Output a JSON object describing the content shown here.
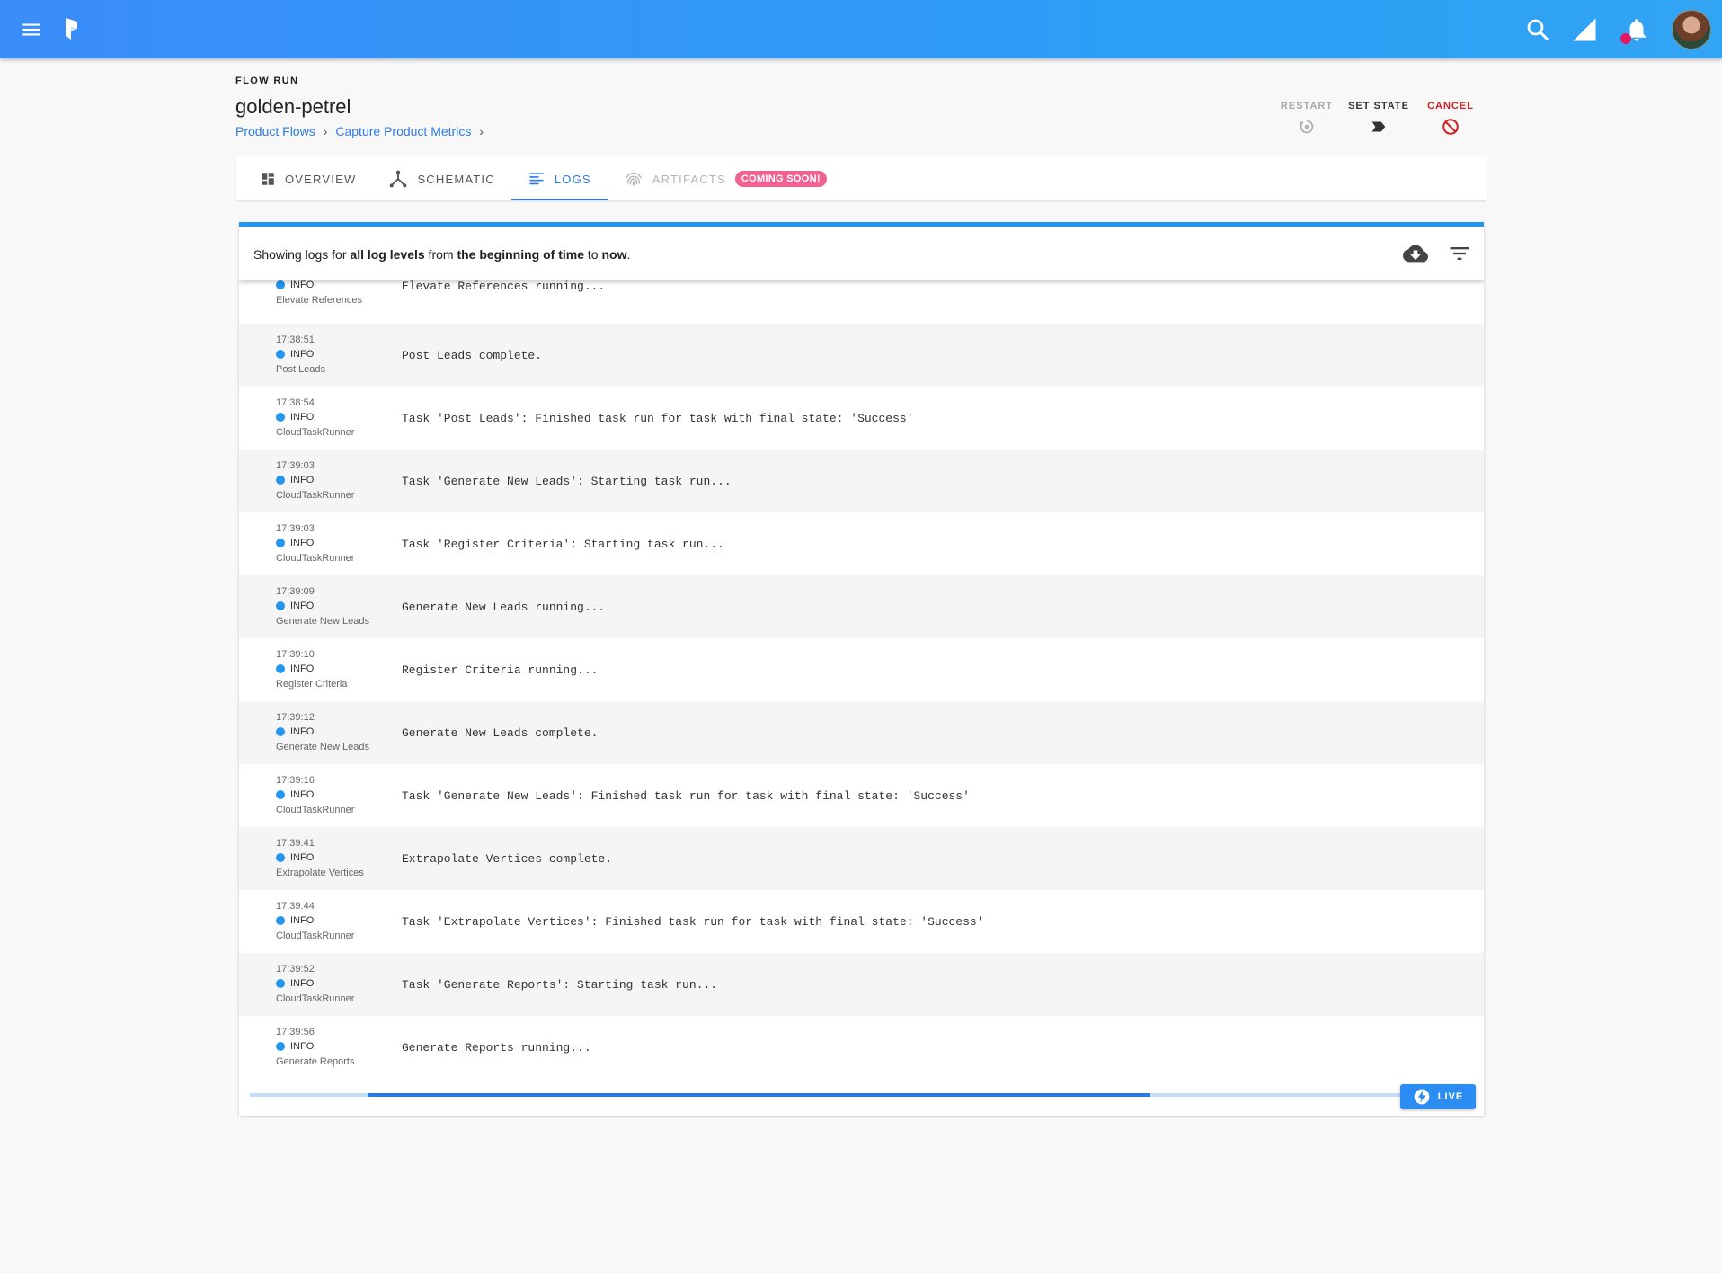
{
  "header": {
    "overline": "FLOW RUN",
    "title": "golden-petrel",
    "breadcrumbs": [
      "Product Flows",
      "Capture Product Metrics"
    ]
  },
  "actions": {
    "restart": "RESTART",
    "set_state": "SET STATE",
    "cancel": "CANCEL"
  },
  "tabs": [
    {
      "label": "OVERVIEW",
      "icon": "dashboard-icon"
    },
    {
      "label": "SCHEMATIC",
      "icon": "schematic-icon"
    },
    {
      "label": "LOGS",
      "icon": "logs-icon",
      "active": true
    },
    {
      "label": "ARTIFACTS",
      "icon": "fingerprint-icon",
      "disabled": true,
      "badge": "COMING SOON!"
    }
  ],
  "log_summary": {
    "prefix": "Showing logs for ",
    "levels": "all log levels",
    "from_word": " from ",
    "start": "the beginning of time",
    "to_word": " to ",
    "end": "now",
    "suffix": "."
  },
  "logs": [
    {
      "time": "",
      "level": "INFO",
      "source": "Elevate References",
      "message": "Elevate References running..."
    },
    {
      "time": "17:38:51",
      "level": "INFO",
      "source": "Post Leads",
      "message": "Post Leads complete."
    },
    {
      "time": "17:38:54",
      "level": "INFO",
      "source": "CloudTaskRunner",
      "message": "Task 'Post Leads': Finished task run for task with final state: 'Success'"
    },
    {
      "time": "17:39:03",
      "level": "INFO",
      "source": "CloudTaskRunner",
      "message": "Task 'Generate New Leads': Starting task run..."
    },
    {
      "time": "17:39:03",
      "level": "INFO",
      "source": "CloudTaskRunner",
      "message": "Task 'Register Criteria': Starting task run..."
    },
    {
      "time": "17:39:09",
      "level": "INFO",
      "source": "Generate New Leads",
      "message": "Generate New Leads running..."
    },
    {
      "time": "17:39:10",
      "level": "INFO",
      "source": "Register Criteria",
      "message": "Register Criteria running..."
    },
    {
      "time": "17:39:12",
      "level": "INFO",
      "source": "Generate New Leads",
      "message": "Generate New Leads complete."
    },
    {
      "time": "17:39:16",
      "level": "INFO",
      "source": "CloudTaskRunner",
      "message": "Task 'Generate New Leads': Finished task run for task with final state: 'Success'"
    },
    {
      "time": "17:39:41",
      "level": "INFO",
      "source": "Extrapolate Vertices",
      "message": "Extrapolate Vertices complete."
    },
    {
      "time": "17:39:44",
      "level": "INFO",
      "source": "CloudTaskRunner",
      "message": "Task 'Extrapolate Vertices': Finished task run for task with final state: 'Success'"
    },
    {
      "time": "17:39:52",
      "level": "INFO",
      "source": "CloudTaskRunner",
      "message": "Task 'Generate Reports': Starting task run..."
    },
    {
      "time": "17:39:56",
      "level": "INFO",
      "source": "Generate Reports",
      "message": "Generate Reports running..."
    }
  ],
  "live": {
    "label": "LIVE"
  },
  "colors": {
    "accent": "#2c7be5",
    "info_dot": "#2496f0",
    "cancel": "#cf1f22",
    "badge": "#f06292"
  }
}
